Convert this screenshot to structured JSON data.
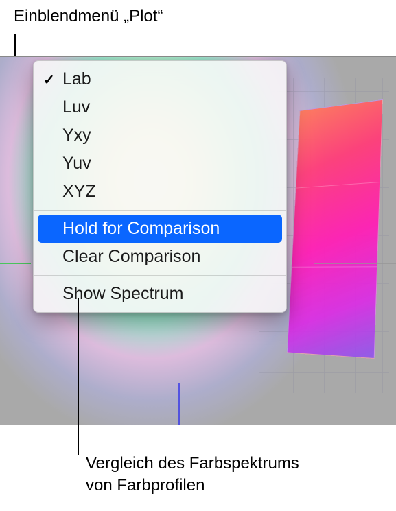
{
  "annotations": {
    "top": "Einblendmenü „Plot“",
    "bottom_line1": "Vergleich des Farbspektrums",
    "bottom_line2": "von Farbprofilen"
  },
  "menu": {
    "color_spaces": [
      {
        "label": "Lab",
        "checked": true
      },
      {
        "label": "Luv",
        "checked": false
      },
      {
        "label": "Yxy",
        "checked": false
      },
      {
        "label": "Yuv",
        "checked": false
      },
      {
        "label": "XYZ",
        "checked": false
      }
    ],
    "hold_label": "Hold for Comparison",
    "clear_label": "Clear Comparison",
    "spectrum_label": "Show Spectrum",
    "checkmark": "✓"
  }
}
